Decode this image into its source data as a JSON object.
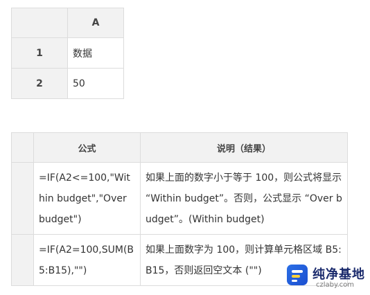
{
  "table1": {
    "column_header": "A",
    "rows": [
      {
        "num": "1",
        "value": "数据"
      },
      {
        "num": "2",
        "value": "50"
      }
    ]
  },
  "table2": {
    "headers": {
      "formula": "公式",
      "description": "说明（结果）"
    },
    "rows": [
      {
        "formula": "=IF(A2<=100,\"Within budget\",\"Over budget\")",
        "description": "如果上面的数字小于等于 100，则公式将显示 “Within budget”。否则，公式显示 “Over budget”。(Within budget)"
      },
      {
        "formula": "=IF(A2=100,SUM(B5:B15),\"\")",
        "description": "如果上面数字为 100，则计算单元格区域 B5:B15，否则返回空文本 (\"\")"
      }
    ]
  },
  "watermark": {
    "title": "纯净基地",
    "site": "czlaby.com",
    "icon": "logo-icon"
  }
}
